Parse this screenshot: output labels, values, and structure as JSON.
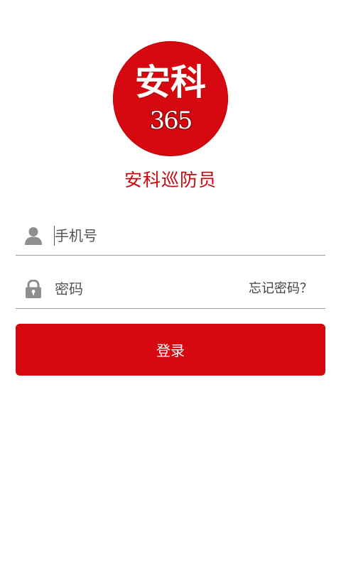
{
  "logo": {
    "main_text": "安科",
    "sub_text": "365"
  },
  "app_title": "安科巡防员",
  "phone_field": {
    "placeholder": "手机号",
    "icon": "user-icon"
  },
  "password_field": {
    "placeholder": "密码",
    "icon": "lock-icon",
    "forgot_label": "忘记密码？"
  },
  "login_button": {
    "label": "登录"
  },
  "colors": {
    "brand_red": "#d4080e",
    "title_red": "#c8090f",
    "icon_gray": "#8e8e8e",
    "divider_gray": "#9a9a9a"
  }
}
